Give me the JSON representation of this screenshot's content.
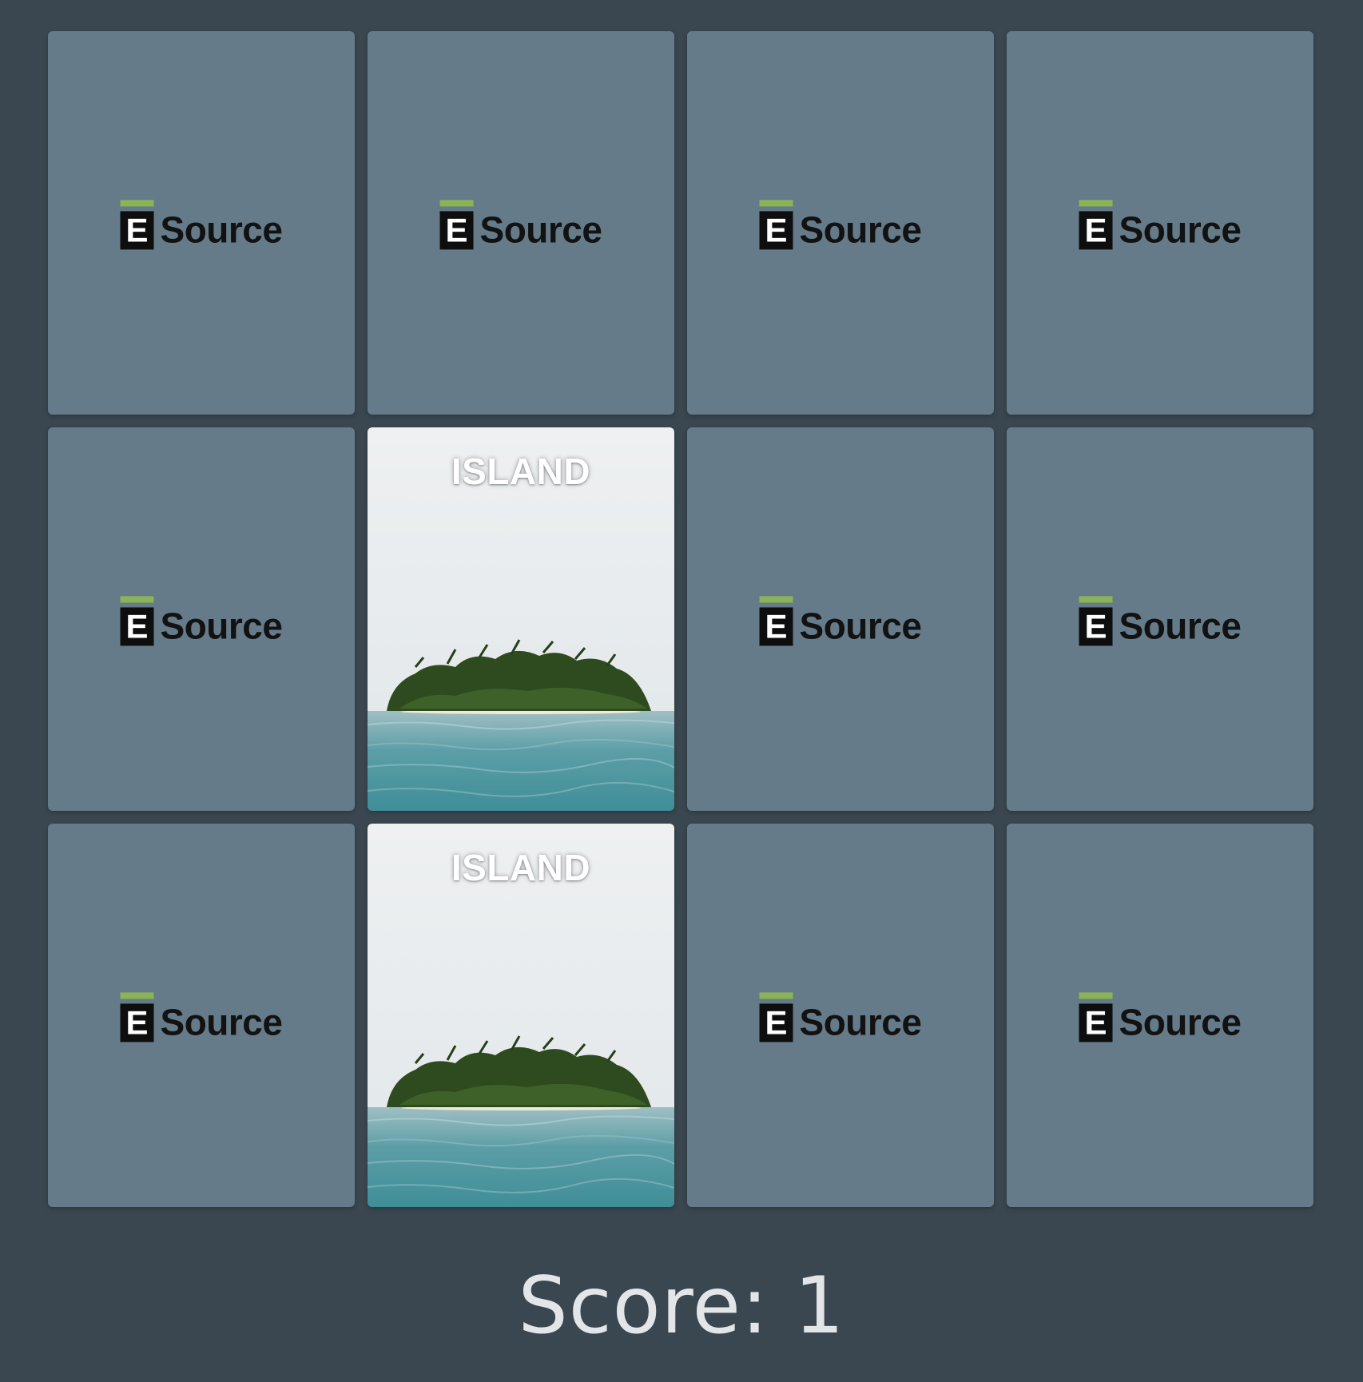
{
  "brand": {
    "logo_letter": "E",
    "logo_word": "Source",
    "logo_accent_color": "#8bb455"
  },
  "cards": [
    {
      "state": "face-down"
    },
    {
      "state": "face-down"
    },
    {
      "state": "face-down"
    },
    {
      "state": "face-down"
    },
    {
      "state": "face-down"
    },
    {
      "state": "face-up",
      "label": "ISLAND",
      "image": "tropical-island-photo"
    },
    {
      "state": "face-down"
    },
    {
      "state": "face-down"
    },
    {
      "state": "face-down"
    },
    {
      "state": "face-up",
      "label": "ISLAND",
      "image": "tropical-island-photo"
    },
    {
      "state": "face-down"
    },
    {
      "state": "face-down"
    }
  ],
  "score": {
    "text": "Score: 1"
  },
  "colors": {
    "background": "#3a4750",
    "card_back": "#657b89"
  }
}
